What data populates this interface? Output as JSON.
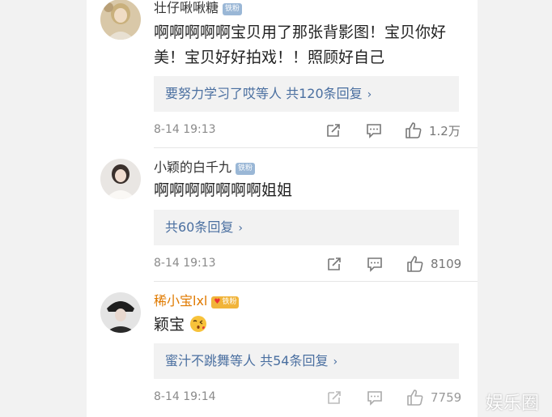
{
  "comments": [
    {
      "username": "壮仔啾啾糖",
      "badge": "铁粉",
      "text_line1": "啊啊啊啊啊宝贝用了那张背影图！宝贝你好",
      "text_line2": "美！宝贝好好拍戏！！照顾好自己",
      "reply_summary": "要努力学习了哎等人 共120条回复",
      "time": "8-14 19:13",
      "likes": "1.2万"
    },
    {
      "username": "小颖的白千九",
      "badge": "铁粉",
      "text_line1": "啊啊啊啊啊啊啊姐姐",
      "reply_summary": "共60条回复",
      "time": "8-14 19:13",
      "likes": "8109"
    },
    {
      "username": "稀小宝lxl",
      "badge": "铁粉",
      "text_line1": "颖宝",
      "reply_summary": "蜜汁不跳舞等人 共54条回复",
      "time": "8-14 19:14",
      "likes": "7759"
    }
  ],
  "icons": {
    "share": "share-icon",
    "comment": "comment-icon",
    "like": "thumbs-up-icon",
    "emoji": "kiss-face-emoji"
  },
  "colors": {
    "reply_link": "#4a6fa0",
    "vip_name": "#e07a00",
    "badge_blue": "#9ab7d6",
    "badge_gold": "#f1b43a"
  },
  "watermark": "娱乐圈"
}
